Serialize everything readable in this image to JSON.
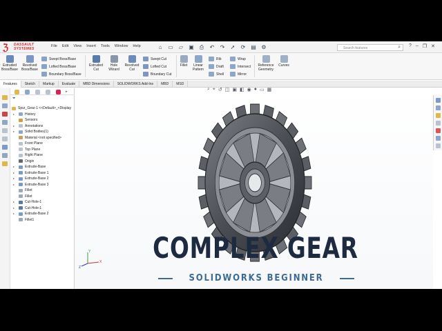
{
  "brand": {
    "line1": "DASSAULT",
    "line2": "SYSTEMES"
  },
  "menu": [
    "File",
    "Edit",
    "View",
    "Insert",
    "Tools",
    "Window",
    "Help"
  ],
  "search": {
    "placeholder": "Search features"
  },
  "ribbon": {
    "extruded_boss": "Extruded Boss/Base",
    "revolved_boss": "Revolved Boss/Base",
    "swept_boss": "Swept Boss/Base",
    "lofted_boss": "Lofted Boss/Base",
    "boundary_boss": "Boundary Boss/Base",
    "extruded_cut": "Extruded Cut",
    "hole_wizard": "Hole Wizard",
    "revolved_cut": "Revolved Cut",
    "swept_cut": "Swept Cut",
    "lofted_cut": "Lofted Cut",
    "boundary_cut": "Boundary Cut",
    "fillet": "Fillet",
    "linear_pattern": "Linear Pattern",
    "rib": "Rib",
    "draft": "Draft",
    "shell": "Shell",
    "wrap": "Wrap",
    "intersect": "Intersect",
    "mirror": "Mirror",
    "reference_geometry": "Reference Geometry",
    "curves": "Curves"
  },
  "tabs": [
    "Features",
    "Sketch",
    "Markup",
    "Evaluate",
    "MBD Dimensions",
    "SOLIDWORKS Add-Ins",
    "MBD",
    "MSD"
  ],
  "tree": {
    "root": "Spur_Gear-1 <<Default>_<Display",
    "items": [
      {
        "label": "History",
        "indent": 1
      },
      {
        "label": "Sensors",
        "indent": 1
      },
      {
        "label": "Annotations",
        "indent": 1
      },
      {
        "label": "Solid Bodies(1)",
        "indent": 1
      },
      {
        "label": "Material <not specified>",
        "indent": 1
      },
      {
        "label": "Front Plane",
        "indent": 1
      },
      {
        "label": "Top Plane",
        "indent": 1
      },
      {
        "label": "Right Plane",
        "indent": 1
      },
      {
        "label": "Origin",
        "indent": 1
      },
      {
        "label": "Extrude-Base",
        "indent": 1
      },
      {
        "label": "Extrude-Base 1",
        "indent": 1
      },
      {
        "label": "Extrude-Base 2",
        "indent": 1
      },
      {
        "label": "Extrude-Base 3",
        "indent": 1
      },
      {
        "label": "Fillet",
        "indent": 1
      },
      {
        "label": "Fillet",
        "indent": 1
      },
      {
        "label": "Cut-Hole-1",
        "indent": 1
      },
      {
        "label": "Cut-Hole-1",
        "indent": 1
      },
      {
        "label": "Extrude-Base 2",
        "indent": 1
      },
      {
        "label": "Fillet1",
        "indent": 1
      }
    ]
  },
  "overlay": {
    "title": "COMPLEX GEAR",
    "subtitle": "SOLIDWORKS BEGINNER"
  },
  "colors": {
    "accent": "#3e6a94",
    "title": "#1d2a3f",
    "brand": "#d7262c"
  }
}
